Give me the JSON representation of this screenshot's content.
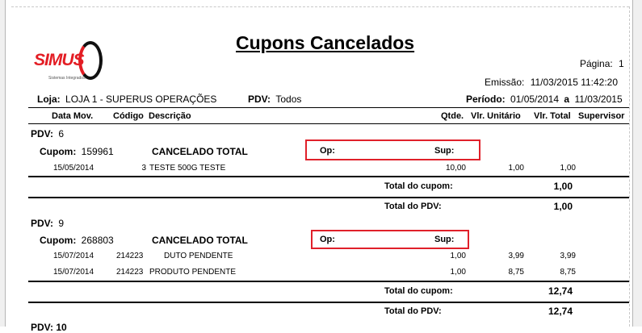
{
  "report": {
    "title": "Cupons Cancelados",
    "page_label": "Página:",
    "page_number": "1",
    "emission_label": "Emissão:",
    "emission_value": "11/03/2015 11:42:20"
  },
  "logo": {
    "brand": "SIMUS",
    "tagline": "Sistemas Integrados"
  },
  "filters": {
    "loja_label": "Loja:",
    "loja_value": "LOJA 1 - SUPERUS OPERAÇÕES",
    "pdv_label": "PDV:",
    "pdv_value": "Todos",
    "periodo_label": "Período:",
    "periodo_start": "01/05/2014",
    "periodo_sep": "a",
    "periodo_end": "11/03/2015"
  },
  "columns": {
    "data_mov": "Data Mov.",
    "codigo": "Código",
    "descricao": "Descrição",
    "qtde": "Qtde.",
    "vlr_unitario": "Vlr. Unitário",
    "vlr_total": "Vlr. Total",
    "supervisor": "Supervisor"
  },
  "groups": [
    {
      "pdv_label": "PDV:",
      "pdv": "6",
      "cupom_label": "Cupom:",
      "cupom": "159961",
      "status": "CANCELADO TOTAL",
      "op_label": "Op:",
      "sup_label": "Sup:",
      "items": [
        {
          "date": "15/05/2014",
          "code": "3",
          "desc": "TESTE 500G TESTE",
          "qty": "10,00",
          "unit": "1,00",
          "total": "1,00"
        }
      ],
      "total_cupom_label": "Total do cupom:",
      "total_cupom": "1,00",
      "total_pdv_label": "Total do PDV:",
      "total_pdv": "1,00"
    },
    {
      "pdv_label": "PDV:",
      "pdv": "9",
      "cupom_label": "Cupom:",
      "cupom": "268803",
      "status": "CANCELADO TOTAL",
      "op_label": "Op:",
      "sup_label": "Sup:",
      "items": [
        {
          "date": "15/07/2014",
          "code": "214223",
          "desc": "DUTO PENDENTE",
          "qty": "1,00",
          "unit": "3,99",
          "total": "3,99"
        },
        {
          "date": "15/07/2014",
          "code": "214223",
          "desc": "PRODUTO PENDENTE",
          "qty": "1,00",
          "unit": "8,75",
          "total": "8,75"
        }
      ],
      "total_cupom_label": "Total do cupom:",
      "total_cupom": "12,74",
      "total_pdv_label": "Total do PDV:",
      "total_pdv": "12,74"
    }
  ],
  "next_pdv_partial": "PDV: 10"
}
